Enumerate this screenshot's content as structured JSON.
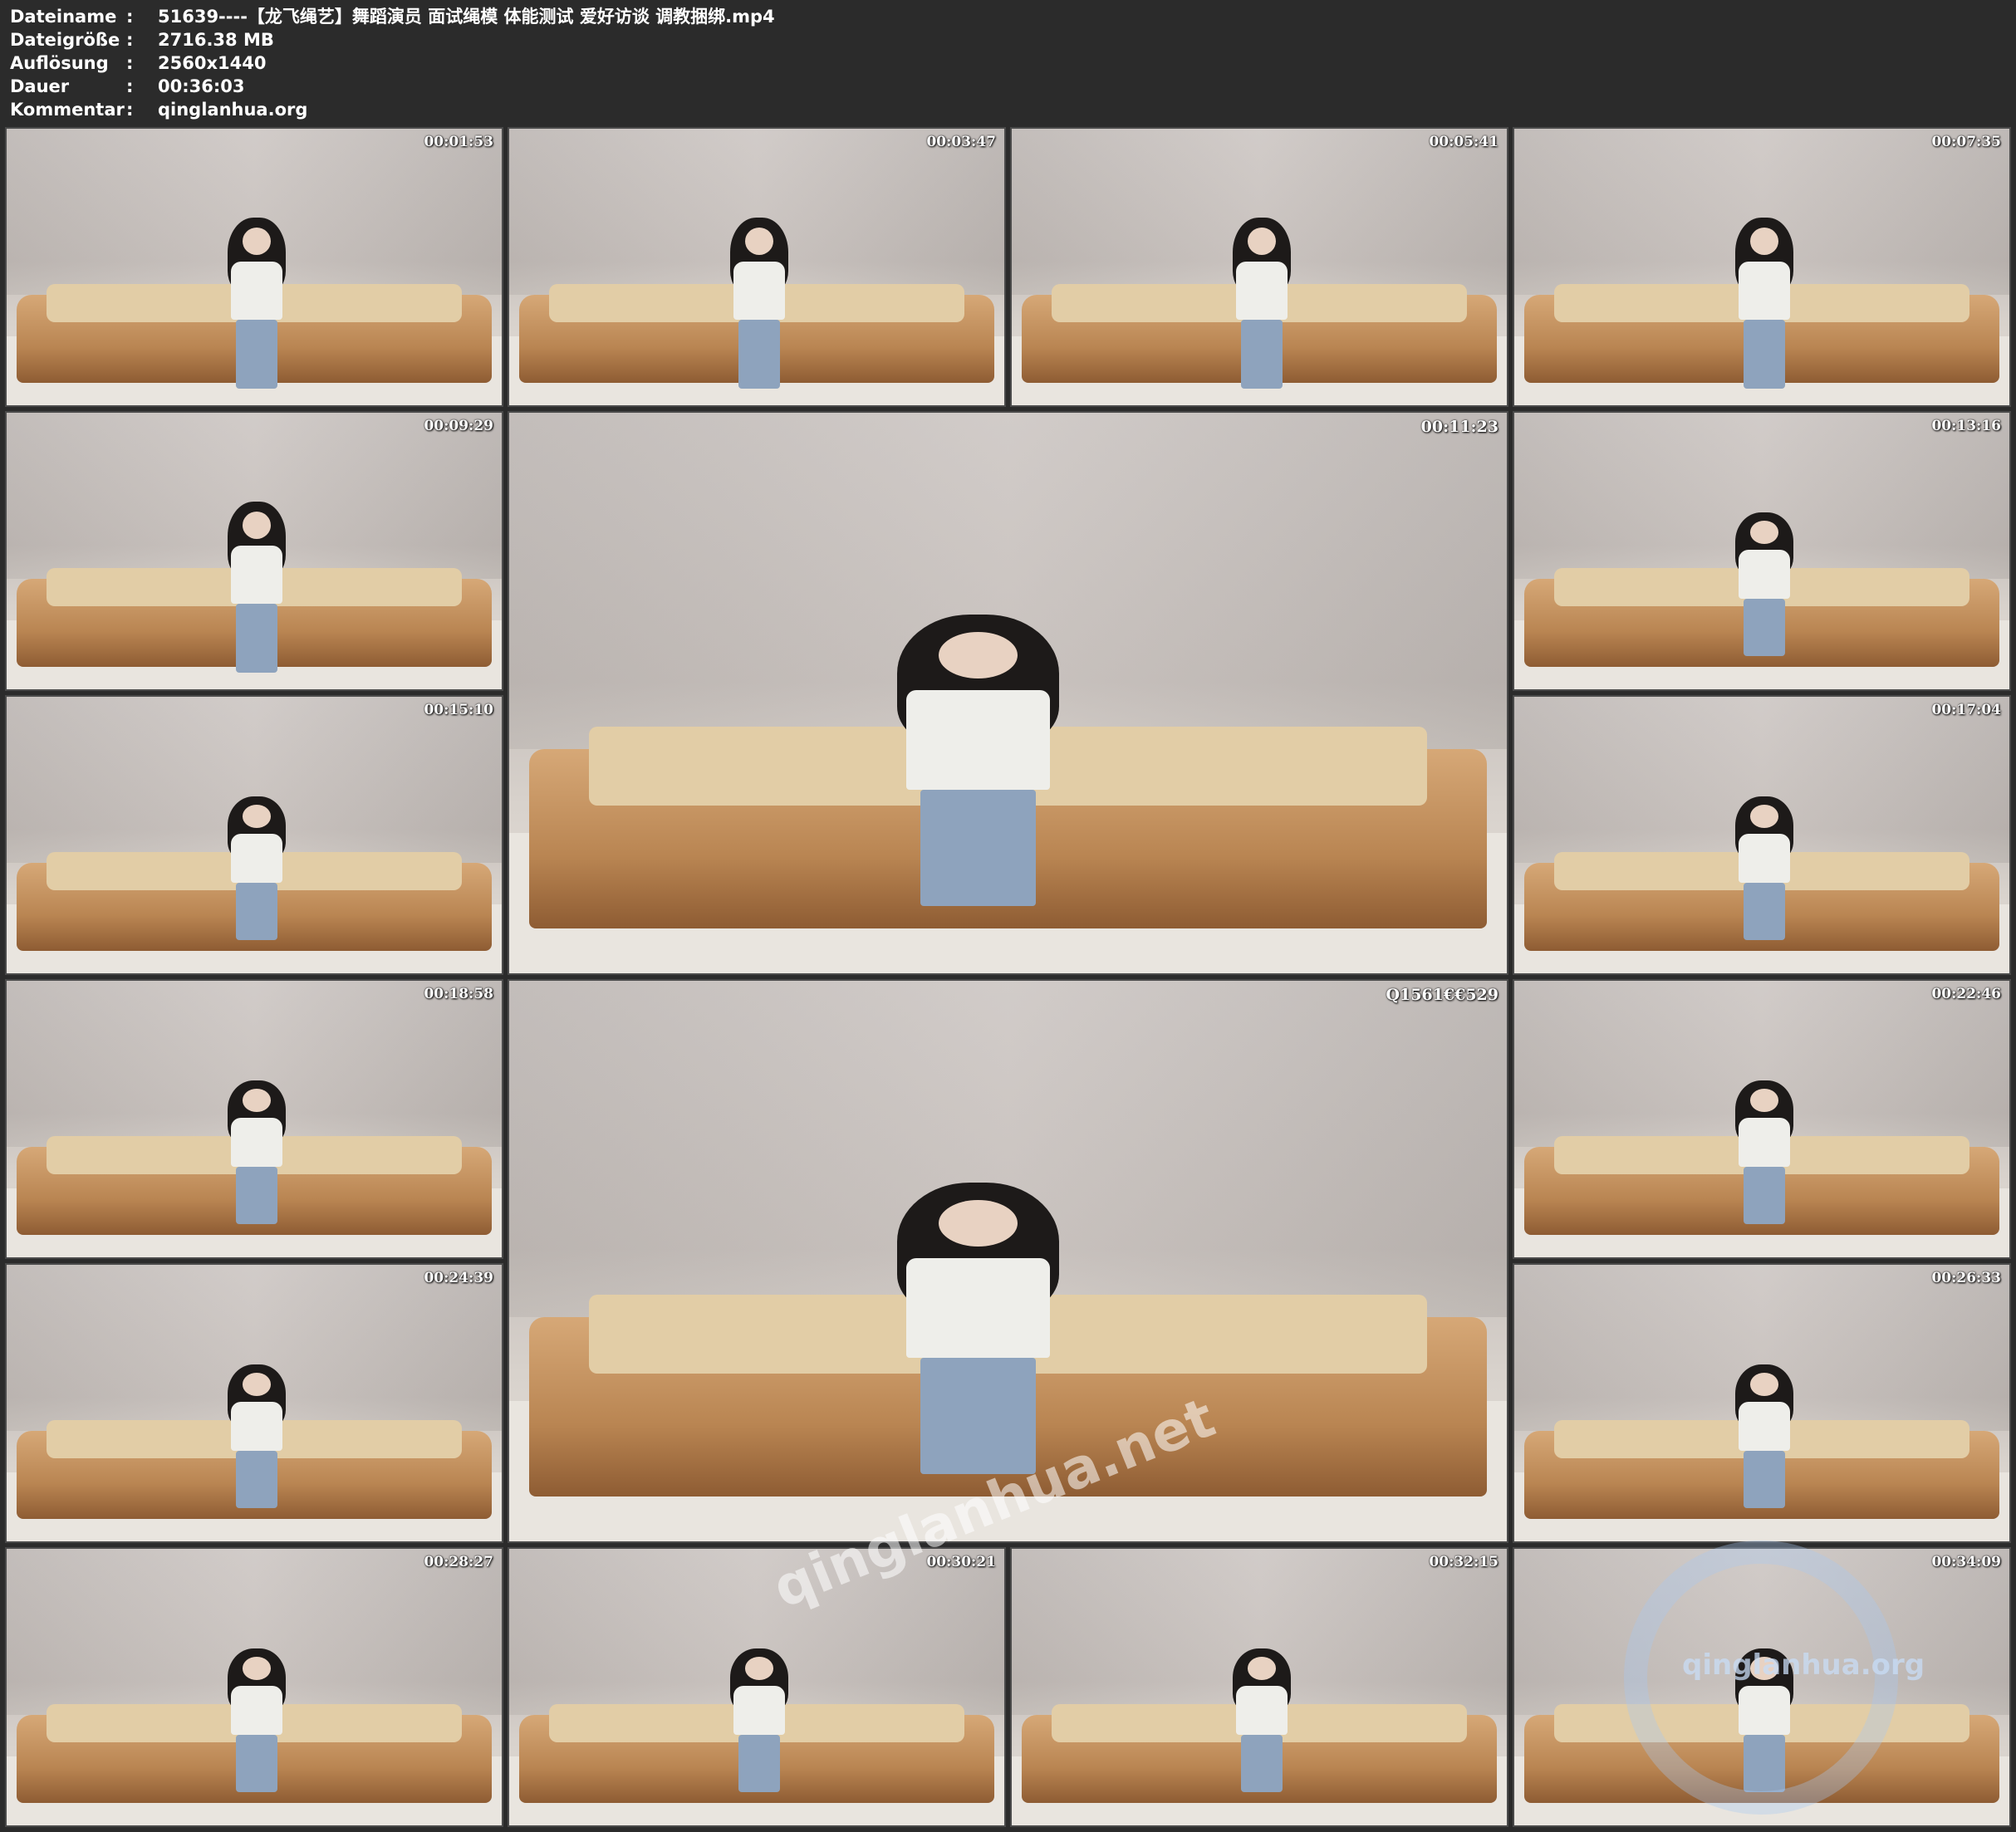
{
  "header": {
    "rows": [
      {
        "key": "Dateiname",
        "sep": ":",
        "value": "51639----【龙飞绳艺】舞蹈演员 面试绳模 体能测试 爱好访谈 调教捆绑.mp4"
      },
      {
        "key": "Dateigröße",
        "sep": ":",
        "value": "2716.38 MB"
      },
      {
        "key": "Auflösung",
        "sep": ":",
        "value": "2560x1440"
      },
      {
        "key": "Dauer",
        "sep": ":",
        "value": "00:36:03"
      },
      {
        "key": "Kommentar",
        "sep": ":",
        "value": "qinglanhua.org"
      }
    ]
  },
  "thumbnails": [
    {
      "timestamp": "00:01:53",
      "pose": "standing"
    },
    {
      "timestamp": "00:03:47",
      "pose": "arms-out"
    },
    {
      "timestamp": "00:05:41",
      "pose": "standing-far"
    },
    {
      "timestamp": "00:07:35",
      "pose": "standing-close"
    },
    {
      "timestamp": "00:09:29",
      "pose": "standing"
    },
    {
      "timestamp": "00:11:23",
      "pose": "sitting",
      "large": true
    },
    {
      "timestamp": "00:13:16",
      "pose": "sitting"
    },
    {
      "timestamp": "00:15:10",
      "pose": "sitting"
    },
    {
      "timestamp": "00:17:04",
      "pose": "sitting"
    },
    {
      "timestamp": "00:18:58",
      "pose": "sitting"
    },
    {
      "timestamp": "Q1561€€529",
      "pose": "sitting-bowed",
      "large": true
    },
    {
      "timestamp": "00:22:46",
      "pose": "sitting-bent"
    },
    {
      "timestamp": "00:24:39",
      "pose": "sitting"
    },
    {
      "timestamp": "00:26:33",
      "pose": "sitting"
    },
    {
      "timestamp": "00:28:27",
      "pose": "sitting-close"
    },
    {
      "timestamp": "00:30:21",
      "pose": "kneeling"
    },
    {
      "timestamp": "00:32:15",
      "pose": "sitting-sofa"
    },
    {
      "timestamp": "00:34:09",
      "pose": "crouching"
    }
  ],
  "watermarks": {
    "diagonal": "qinglanhua.net",
    "corner": "qinglanhua.org"
  },
  "colors": {
    "background": "#2b2b2b",
    "header_text": "#ffffff",
    "sofa": "#b98552",
    "wall": "#c9c3bf"
  }
}
